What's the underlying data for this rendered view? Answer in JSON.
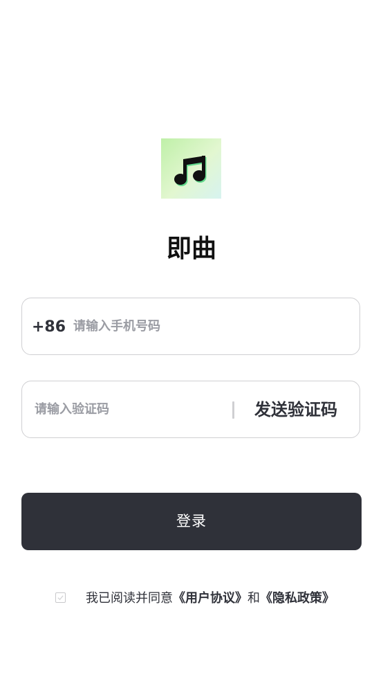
{
  "app": {
    "icon": "music-note-icon",
    "title": "即曲"
  },
  "phone": {
    "country_code": "+86",
    "value": "",
    "placeholder": "请输入手机号码"
  },
  "code": {
    "value": "",
    "placeholder": "请输入验证码",
    "send_label": "发送验证码"
  },
  "login": {
    "label": "登录"
  },
  "agreement": {
    "checked": false,
    "prefix": "我已阅读并同意",
    "user_agreement": "《用户协议》",
    "conjunction": "和",
    "privacy_policy": "《隐私政策》"
  },
  "colors": {
    "primary": "#2f3139",
    "border": "#cfcfd2",
    "placeholder": "#9a9ca3",
    "icon_bg_start": "#bff0a8",
    "icon_bg_end": "#d7f3f0"
  }
}
